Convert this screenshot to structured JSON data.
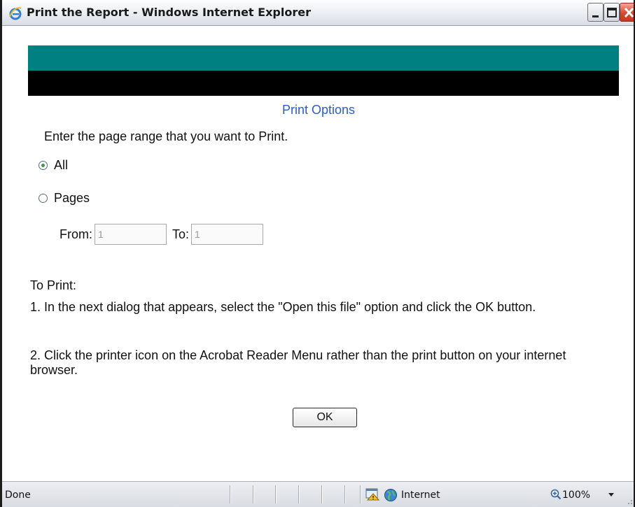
{
  "window": {
    "title": "Print the Report - Windows Internet Explorer",
    "icon": "ie-logo-icon",
    "controls": [
      "minimize-icon",
      "maximize-icon",
      "close-icon"
    ]
  },
  "colors": {
    "band_top": "#008080",
    "band_bottom": "#000000",
    "heading": "#2a5bd7"
  },
  "form": {
    "heading": "Print Options",
    "instruction": "Enter the page range that you want to Print.",
    "options": [
      {
        "label": "All",
        "selected": true
      },
      {
        "label": "Pages",
        "selected": false
      }
    ],
    "from_label": "From:",
    "from_value": "1",
    "to_label": "To:",
    "to_value": "1"
  },
  "help": {
    "title": "To Print:",
    "steps": [
      "1. In the next dialog that appears, select the \"Open this file\" option and click the OK button.",
      "2. Click the printer icon on the Acrobat Reader Menu rather than the print button on your internet browser."
    ]
  },
  "ok_label": "OK",
  "status": {
    "text": "Done",
    "zone": "Internet",
    "zoom": "100%"
  }
}
